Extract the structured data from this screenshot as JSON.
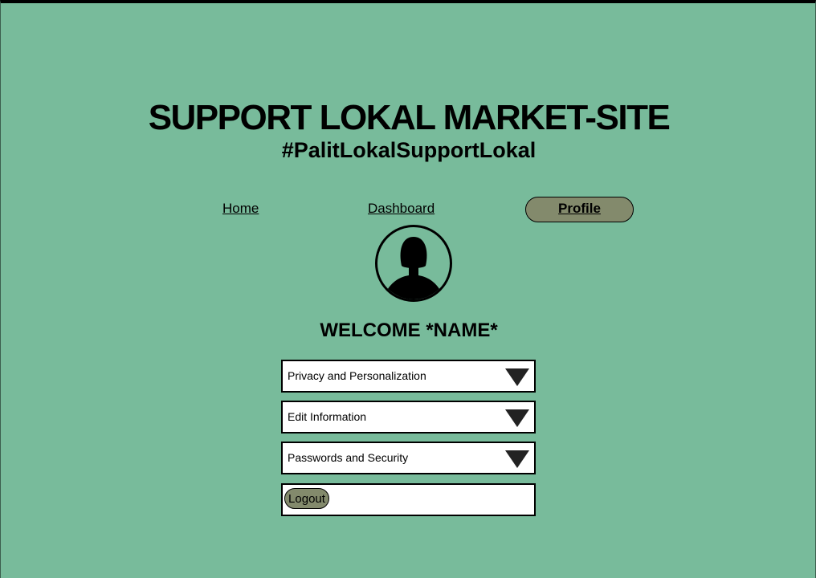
{
  "header": {
    "title": "SUPPORT LOKAL MARKET-SITE",
    "tagline": "#PalitLokalSupportLokal"
  },
  "nav": {
    "home": "Home",
    "dashboard": "Dashboard",
    "profile": "Profile",
    "active": "Profile"
  },
  "profile": {
    "avatar_icon": "user-silhouette-icon",
    "welcome": "WELCOME *NAME*"
  },
  "menu": {
    "items": [
      {
        "label": "Privacy and Personalization",
        "icon": "caret-down-icon"
      },
      {
        "label": "Edit Information",
        "icon": "caret-down-icon"
      },
      {
        "label": "Passwords and Security",
        "icon": "caret-down-icon"
      }
    ],
    "logout_label": "Logout"
  },
  "colors": {
    "background": "#78bb9b",
    "active_pill": "#838a6c",
    "button": "#838a6c"
  }
}
